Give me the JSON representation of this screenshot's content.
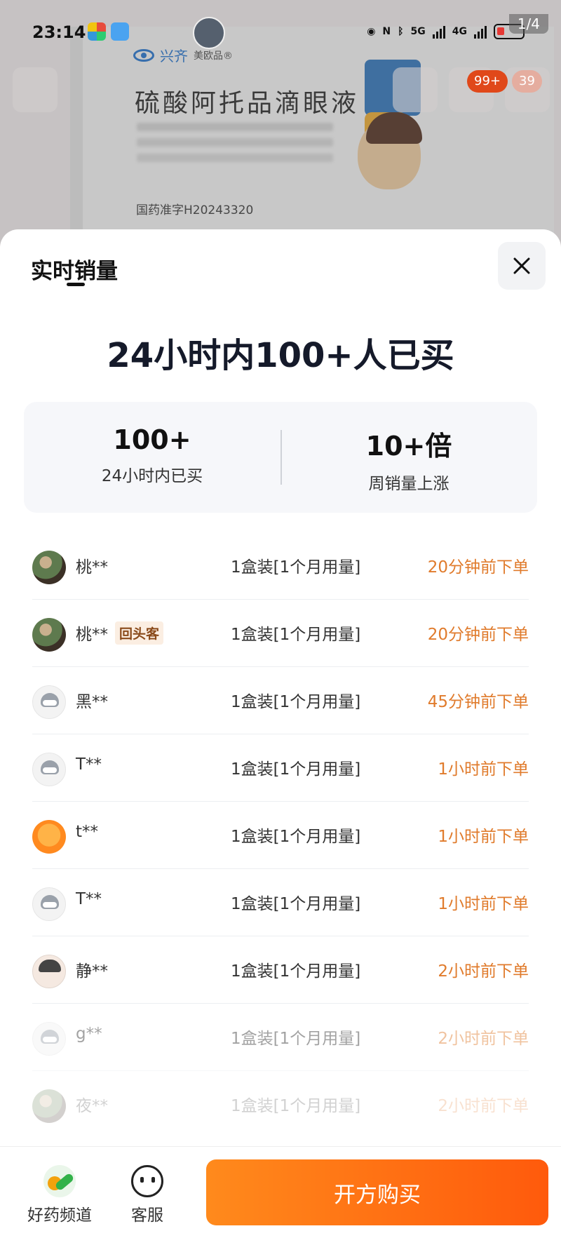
{
  "status_bar": {
    "time": "23:14",
    "network_5g": "5G",
    "network_4g": "4G",
    "page_indicator": "1/4"
  },
  "background": {
    "brand": "兴齐",
    "brand_sub": "美欧品®",
    "product_title": "硫酸阿托品滴眼液",
    "registration": "国药准字H20243320",
    "badge_cart": "99+",
    "badge_msg": "39"
  },
  "sheet": {
    "tab_title": "实时销量",
    "headline": "24小时内100+人已买",
    "stats": [
      {
        "value": "100+",
        "label": "24小时内已买"
      },
      {
        "value": "10+倍",
        "label": "周销量上涨"
      }
    ],
    "orders": [
      {
        "name": "桃**",
        "tag": "",
        "spec": "1盒装[1个月用量]",
        "time": "20分钟前下单",
        "avatar": "photo"
      },
      {
        "name": "桃**",
        "tag": "回头客",
        "spec": "1盒装[1个月用量]",
        "time": "20分钟前下单",
        "avatar": "photo"
      },
      {
        "name": "黑**",
        "tag": "",
        "spec": "1盒装[1个月用量]",
        "time": "45分钟前下单",
        "avatar": "robot"
      },
      {
        "name": "T**",
        "tag": "",
        "spec": "1盒装[1个月用量]",
        "time": "1小时前下单",
        "avatar": "robot"
      },
      {
        "name": "t**",
        "tag": "",
        "spec": "1盒装[1个月用量]",
        "time": "1小时前下单",
        "avatar": "duck"
      },
      {
        "name": "T**",
        "tag": "",
        "spec": "1盒装[1个月用量]",
        "time": "1小时前下单",
        "avatar": "robot"
      },
      {
        "name": "静**",
        "tag": "",
        "spec": "1盒装[1个月用量]",
        "time": "2小时前下单",
        "avatar": "girl"
      },
      {
        "name": "g**",
        "tag": "",
        "spec": "1盒装[1个月用量]",
        "time": "2小时前下单",
        "avatar": "robot"
      },
      {
        "name": "夜**",
        "tag": "",
        "spec": "1盒装[1个月用量]",
        "time": "2小时前下单",
        "avatar": "photo"
      }
    ]
  },
  "bottom_bar": {
    "channel_label": "好药频道",
    "service_label": "客服",
    "buy_label": "开方购买"
  },
  "colors": {
    "accent": "#ff6a14",
    "time_text": "#e07b2c",
    "tag_bg": "#fbeee2"
  }
}
